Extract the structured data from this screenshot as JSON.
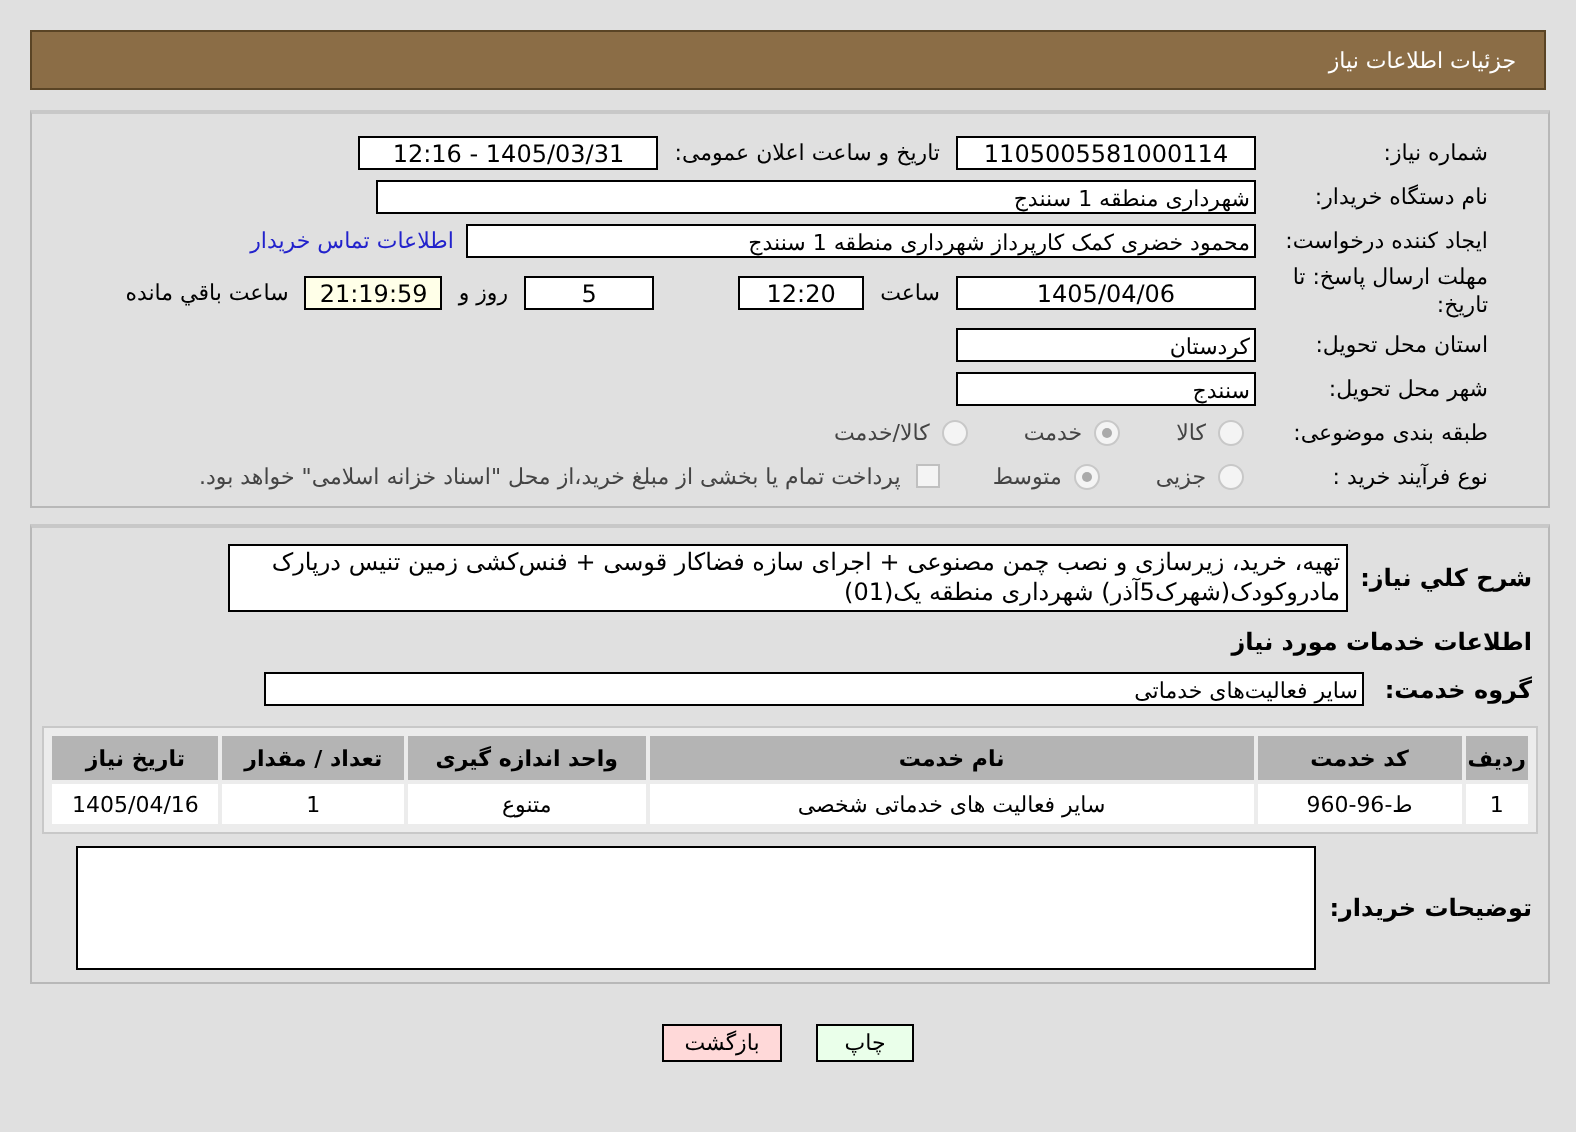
{
  "header": {
    "title": "جزئیات اطلاعات نیاز"
  },
  "need_number": {
    "label": "شماره نیاز:",
    "value": "1105005581000114"
  },
  "announce": {
    "label": "تاریخ و ساعت اعلان عمومی:",
    "value": "1405/03/31 - 12:16"
  },
  "buyer_org": {
    "label": "نام دستگاه خریدار:",
    "value": "شهرداری منطقه 1 سنندج"
  },
  "requester": {
    "label": "ایجاد کننده درخواست:",
    "value": "محمود خضری کمک کارپرداز شهرداری منطقه 1 سنندج",
    "link": "اطلاعات تماس خریدار"
  },
  "deadline": {
    "label": "مهلت ارسال پاسخ: تا تاریخ:",
    "date": "1405/04/06",
    "time_label": "ساعت",
    "time": "12:20",
    "days": "5",
    "days_label": "روز و",
    "remaining": "21:19:59",
    "remaining_label": "ساعت باقي مانده"
  },
  "province": {
    "label": "استان محل تحویل:",
    "value": "کردستان"
  },
  "city": {
    "label": "شهر محل تحویل:",
    "value": "سنندج"
  },
  "category": {
    "label": "طبقه بندی موضوعی:",
    "options": [
      {
        "label": "کالا",
        "selected": false
      },
      {
        "label": "خدمت",
        "selected": true
      },
      {
        "label": "کالا/خدمت",
        "selected": false
      }
    ]
  },
  "purchase_type": {
    "label": "نوع فرآیند خرید :",
    "options": [
      {
        "label": "جزیی",
        "selected": false
      },
      {
        "label": "متوسط",
        "selected": true
      }
    ],
    "treasury": {
      "checked": false,
      "text": "پرداخت تمام یا بخشی از مبلغ خرید،از محل \"اسناد خزانه اسلامی\" خواهد بود."
    }
  },
  "description": {
    "label": "شرح کلي نياز:",
    "value": "تهیه، خرید، زیرسازی و نصب چمن مصنوعی + اجرای سازه فضاکار قوسی + فنس‌کشی زمین تنیس درپارک مادروکودک(شهرک5آذر) شهرداری منطقه یک(01)"
  },
  "services_title": "اطلاعات خدمات مورد نیاز",
  "service_group": {
    "label": "گروه خدمت:",
    "value": "سایر فعالیت‌های خدماتی"
  },
  "table": {
    "columns": [
      "ردیف",
      "کد خدمت",
      "نام خدمت",
      "واحد اندازه گیری",
      "تعداد / مقدار",
      "تاریخ نیاز"
    ],
    "rows": [
      [
        "1",
        "ط-96-960",
        "سایر فعالیت های خدماتی شخصی",
        "متنوع",
        "1",
        "1405/04/16"
      ]
    ]
  },
  "buyer_notes": {
    "label": "توضیحات خریدار:"
  },
  "buttons": [
    {
      "label": "چاپ",
      "kind": "print"
    },
    {
      "label": "بازگشت",
      "kind": "back"
    }
  ]
}
